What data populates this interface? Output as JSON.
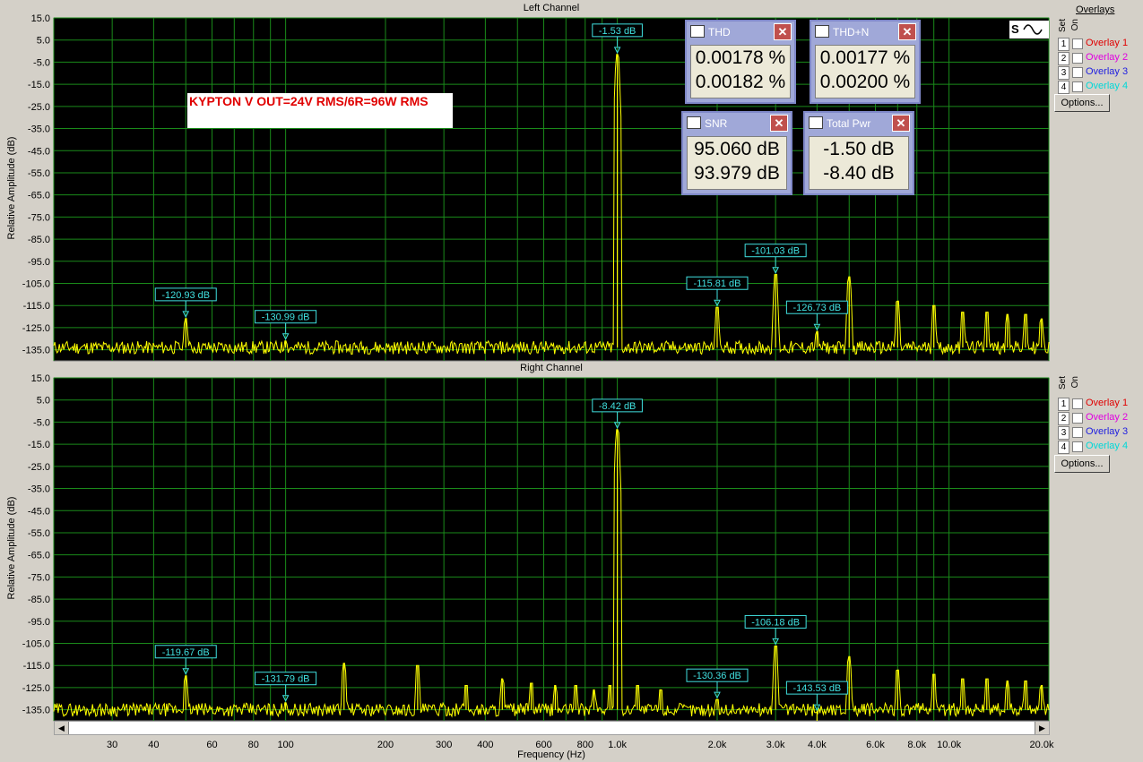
{
  "top_panel": {
    "title": "Left Channel",
    "ylabel": "Relative Amplitude (dB)"
  },
  "bottom_panel": {
    "title": "Right Channel",
    "ylabel": "Relative Amplitude (dB)"
  },
  "xlabel": "Frequency (Hz)",
  "note_text": "KYPTON V OUT=24V RMS/6R=96W RMS",
  "legend": {
    "overlays_label": "Overlays",
    "set_label": "Set",
    "on_label": "On",
    "options_label": "Options...",
    "items": [
      {
        "num": "1",
        "label": "Overlay 1",
        "color": "#e00000"
      },
      {
        "num": "2",
        "label": "Overlay 2",
        "color": "#e000e0"
      },
      {
        "num": "3",
        "label": "Overlay 3",
        "color": "#2020e0"
      },
      {
        "num": "4",
        "label": "Overlay 4",
        "color": "#00d8d8"
      }
    ]
  },
  "meters": {
    "thd": {
      "title": "THD",
      "values": [
        "0.00178 %",
        "0.00182 %"
      ]
    },
    "thdn": {
      "title": "THD+N",
      "values": [
        "0.00177 %",
        "0.00200 %"
      ]
    },
    "snr": {
      "title": "SNR",
      "values": [
        "95.060 dB",
        "93.979 dB"
      ]
    },
    "total_pwr": {
      "title": "Total Pwr",
      "values": [
        "-1.50 dB",
        "-8.40 dB"
      ]
    }
  },
  "chart_data": [
    {
      "type": "line",
      "title": "Left Channel",
      "xlabel": "Frequency (Hz)",
      "ylabel": "Relative Amplitude (dB)",
      "xscale": "log",
      "xlim": [
        20,
        20000
      ],
      "ylim": [
        -140,
        15
      ],
      "grid": true,
      "trace_color": "#ffff00",
      "noise_floor": -134,
      "yticks": [
        "15.0",
        "5.0",
        "-5.0",
        "-15.0",
        "-25.0",
        "-35.0",
        "-45.0",
        "-55.0",
        "-65.0",
        "-75.0",
        "-85.0",
        "-95.0",
        "-105.0",
        "-115.0",
        "-125.0",
        "-135.0"
      ],
      "peaks": [
        {
          "x": 50,
          "y": -120.9
        },
        {
          "x": 100,
          "y": -131.0
        },
        {
          "x": 1000,
          "y": -1.5
        },
        {
          "x": 2000,
          "y": -115.8
        },
        {
          "x": 3000,
          "y": -101.0
        },
        {
          "x": 4000,
          "y": -126.7
        },
        {
          "x": 5000,
          "y": -102
        },
        {
          "x": 7000,
          "y": -113
        },
        {
          "x": 9000,
          "y": -115
        },
        {
          "x": 11000,
          "y": -118
        },
        {
          "x": 13000,
          "y": -118
        },
        {
          "x": 15000,
          "y": -119
        },
        {
          "x": 17000,
          "y": -119
        },
        {
          "x": 19000,
          "y": -121
        }
      ],
      "markers": [
        {
          "x": 1000,
          "y": -1.53,
          "label": "-1.53 dB"
        },
        {
          "x": 50,
          "y": -120.93,
          "label": "-120.93 dB"
        },
        {
          "x": 100,
          "y": -130.99,
          "label": "-130.99 dB"
        },
        {
          "x": 2000,
          "y": -115.81,
          "label": "-115.81 dB"
        },
        {
          "x": 3000,
          "y": -101.03,
          "label": "-101.03 dB"
        },
        {
          "x": 4000,
          "y": -126.73,
          "label": "-126.73 dB"
        }
      ]
    },
    {
      "type": "line",
      "title": "Right Channel",
      "xlabel": "Frequency (Hz)",
      "ylabel": "Relative Amplitude (dB)",
      "xscale": "log",
      "xlim": [
        20,
        20000
      ],
      "ylim": [
        -140,
        15
      ],
      "grid": true,
      "trace_color": "#ffff00",
      "noise_floor": -135,
      "yticks": [
        "15.0",
        "5.0",
        "-5.0",
        "-15.0",
        "-25.0",
        "-35.0",
        "-45.0",
        "-55.0",
        "-65.0",
        "-75.0",
        "-85.0",
        "-95.0",
        "-105.0",
        "-115.0",
        "-125.0",
        "-135.0"
      ],
      "peaks": [
        {
          "x": 50,
          "y": -119.7
        },
        {
          "x": 100,
          "y": -131.8
        },
        {
          "x": 150,
          "y": -114
        },
        {
          "x": 250,
          "y": -115
        },
        {
          "x": 350,
          "y": -124
        },
        {
          "x": 450,
          "y": -121
        },
        {
          "x": 550,
          "y": -123
        },
        {
          "x": 650,
          "y": -124
        },
        {
          "x": 750,
          "y": -124
        },
        {
          "x": 850,
          "y": -126
        },
        {
          "x": 950,
          "y": -124
        },
        {
          "x": 1000,
          "y": -8.4
        },
        {
          "x": 1150,
          "y": -124
        },
        {
          "x": 1350,
          "y": -126
        },
        {
          "x": 2000,
          "y": -130.4
        },
        {
          "x": 3000,
          "y": -106.2
        },
        {
          "x": 4000,
          "y": -143.5
        },
        {
          "x": 5000,
          "y": -111
        },
        {
          "x": 7000,
          "y": -117
        },
        {
          "x": 9000,
          "y": -119
        },
        {
          "x": 11000,
          "y": -121
        },
        {
          "x": 13000,
          "y": -121
        },
        {
          "x": 15000,
          "y": -122
        },
        {
          "x": 17000,
          "y": -122
        },
        {
          "x": 19000,
          "y": -124
        }
      ],
      "markers": [
        {
          "x": 1000,
          "y": -8.42,
          "label": "-8.42 dB"
        },
        {
          "x": 50,
          "y": -119.67,
          "label": "-119.67 dB"
        },
        {
          "x": 100,
          "y": -131.79,
          "label": "-131.79 dB"
        },
        {
          "x": 2000,
          "y": -130.36,
          "label": "-130.36 dB"
        },
        {
          "x": 3000,
          "y": -106.18,
          "label": "-106.18 dB"
        },
        {
          "x": 4000,
          "y": -143.53,
          "label": "-143.53 dB"
        }
      ],
      "xtick_labels": [
        {
          "x": 30,
          "label": "30"
        },
        {
          "x": 40,
          "label": "40"
        },
        {
          "x": 60,
          "label": "60"
        },
        {
          "x": 80,
          "label": "80"
        },
        {
          "x": 100,
          "label": "100"
        },
        {
          "x": 200,
          "label": "200"
        },
        {
          "x": 300,
          "label": "300"
        },
        {
          "x": 400,
          "label": "400"
        },
        {
          "x": 600,
          "label": "600"
        },
        {
          "x": 800,
          "label": "800"
        },
        {
          "x": 1000,
          "label": "1.0k"
        },
        {
          "x": 2000,
          "label": "2.0k"
        },
        {
          "x": 3000,
          "label": "3.0k"
        },
        {
          "x": 4000,
          "label": "4.0k"
        },
        {
          "x": 6000,
          "label": "6.0k"
        },
        {
          "x": 8000,
          "label": "8.0k"
        },
        {
          "x": 10000,
          "label": "10.0k"
        },
        {
          "x": 20000,
          "label": "20.0k"
        }
      ]
    }
  ]
}
